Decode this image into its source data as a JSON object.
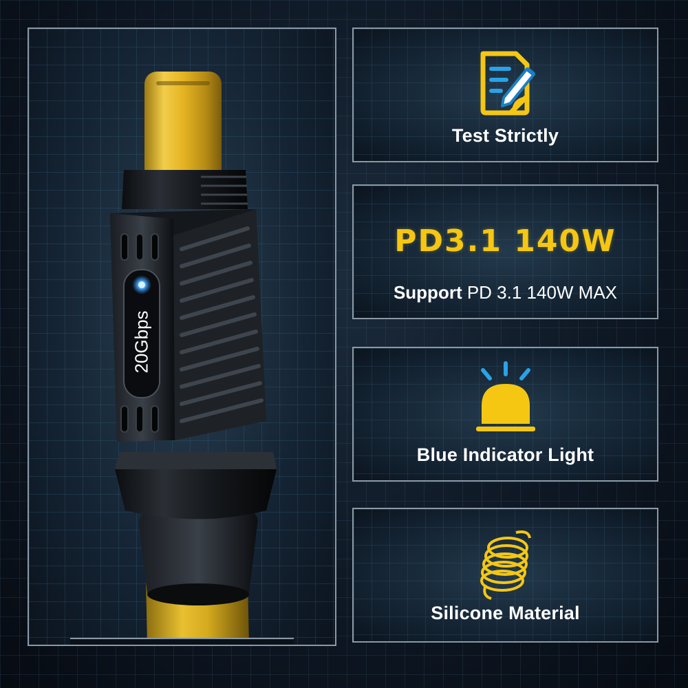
{
  "product": {
    "speed_label": "20Gbps",
    "colors": {
      "cable": "#e0b820",
      "connector_metal": "#e6b422",
      "housing": "#16191d",
      "led": "#4fb3ff"
    }
  },
  "features": [
    {
      "label": "Test Strictly",
      "icon": "document-pen-icon"
    },
    {
      "title": "PD3.1 140W",
      "subtitle_bold": "Support",
      "subtitle_rest": " PD 3.1 140W MAX"
    },
    {
      "label": "Blue Indicator Light",
      "icon": "warning-light-icon"
    },
    {
      "label": "Silicone Material",
      "icon": "coil-icon"
    }
  ],
  "colors": {
    "accent": "#f5c712",
    "accent_blue": "#29a3e8",
    "panel_border": "#8b99a6"
  }
}
